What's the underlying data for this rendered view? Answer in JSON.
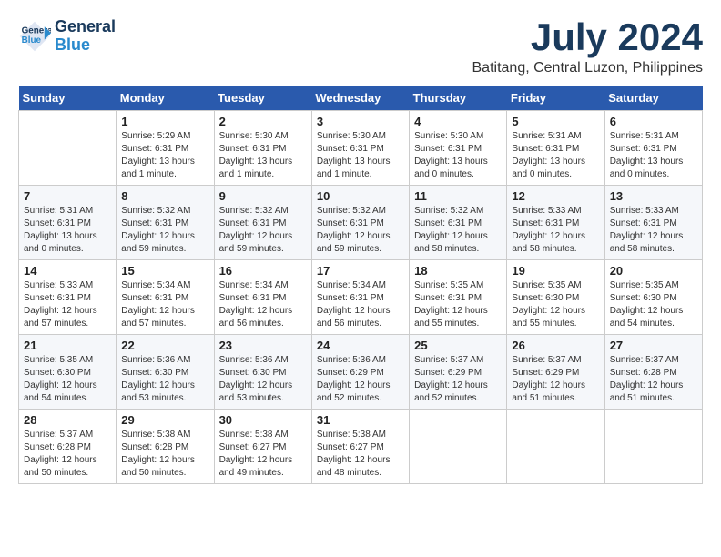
{
  "header": {
    "logo_line1": "General",
    "logo_line2": "Blue",
    "month": "July 2024",
    "location": "Batitang, Central Luzon, Philippines"
  },
  "days_of_week": [
    "Sunday",
    "Monday",
    "Tuesday",
    "Wednesday",
    "Thursday",
    "Friday",
    "Saturday"
  ],
  "weeks": [
    [
      {
        "day": "",
        "info": ""
      },
      {
        "day": "1",
        "info": "Sunrise: 5:29 AM\nSunset: 6:31 PM\nDaylight: 13 hours\nand 1 minute."
      },
      {
        "day": "2",
        "info": "Sunrise: 5:30 AM\nSunset: 6:31 PM\nDaylight: 13 hours\nand 1 minute."
      },
      {
        "day": "3",
        "info": "Sunrise: 5:30 AM\nSunset: 6:31 PM\nDaylight: 13 hours\nand 1 minute."
      },
      {
        "day": "4",
        "info": "Sunrise: 5:30 AM\nSunset: 6:31 PM\nDaylight: 13 hours\nand 0 minutes."
      },
      {
        "day": "5",
        "info": "Sunrise: 5:31 AM\nSunset: 6:31 PM\nDaylight: 13 hours\nand 0 minutes."
      },
      {
        "day": "6",
        "info": "Sunrise: 5:31 AM\nSunset: 6:31 PM\nDaylight: 13 hours\nand 0 minutes."
      }
    ],
    [
      {
        "day": "7",
        "info": "Sunrise: 5:31 AM\nSunset: 6:31 PM\nDaylight: 13 hours\nand 0 minutes."
      },
      {
        "day": "8",
        "info": "Sunrise: 5:32 AM\nSunset: 6:31 PM\nDaylight: 12 hours\nand 59 minutes."
      },
      {
        "day": "9",
        "info": "Sunrise: 5:32 AM\nSunset: 6:31 PM\nDaylight: 12 hours\nand 59 minutes."
      },
      {
        "day": "10",
        "info": "Sunrise: 5:32 AM\nSunset: 6:31 PM\nDaylight: 12 hours\nand 59 minutes."
      },
      {
        "day": "11",
        "info": "Sunrise: 5:32 AM\nSunset: 6:31 PM\nDaylight: 12 hours\nand 58 minutes."
      },
      {
        "day": "12",
        "info": "Sunrise: 5:33 AM\nSunset: 6:31 PM\nDaylight: 12 hours\nand 58 minutes."
      },
      {
        "day": "13",
        "info": "Sunrise: 5:33 AM\nSunset: 6:31 PM\nDaylight: 12 hours\nand 58 minutes."
      }
    ],
    [
      {
        "day": "14",
        "info": "Sunrise: 5:33 AM\nSunset: 6:31 PM\nDaylight: 12 hours\nand 57 minutes."
      },
      {
        "day": "15",
        "info": "Sunrise: 5:34 AM\nSunset: 6:31 PM\nDaylight: 12 hours\nand 57 minutes."
      },
      {
        "day": "16",
        "info": "Sunrise: 5:34 AM\nSunset: 6:31 PM\nDaylight: 12 hours\nand 56 minutes."
      },
      {
        "day": "17",
        "info": "Sunrise: 5:34 AM\nSunset: 6:31 PM\nDaylight: 12 hours\nand 56 minutes."
      },
      {
        "day": "18",
        "info": "Sunrise: 5:35 AM\nSunset: 6:31 PM\nDaylight: 12 hours\nand 55 minutes."
      },
      {
        "day": "19",
        "info": "Sunrise: 5:35 AM\nSunset: 6:30 PM\nDaylight: 12 hours\nand 55 minutes."
      },
      {
        "day": "20",
        "info": "Sunrise: 5:35 AM\nSunset: 6:30 PM\nDaylight: 12 hours\nand 54 minutes."
      }
    ],
    [
      {
        "day": "21",
        "info": "Sunrise: 5:35 AM\nSunset: 6:30 PM\nDaylight: 12 hours\nand 54 minutes."
      },
      {
        "day": "22",
        "info": "Sunrise: 5:36 AM\nSunset: 6:30 PM\nDaylight: 12 hours\nand 53 minutes."
      },
      {
        "day": "23",
        "info": "Sunrise: 5:36 AM\nSunset: 6:30 PM\nDaylight: 12 hours\nand 53 minutes."
      },
      {
        "day": "24",
        "info": "Sunrise: 5:36 AM\nSunset: 6:29 PM\nDaylight: 12 hours\nand 52 minutes."
      },
      {
        "day": "25",
        "info": "Sunrise: 5:37 AM\nSunset: 6:29 PM\nDaylight: 12 hours\nand 52 minutes."
      },
      {
        "day": "26",
        "info": "Sunrise: 5:37 AM\nSunset: 6:29 PM\nDaylight: 12 hours\nand 51 minutes."
      },
      {
        "day": "27",
        "info": "Sunrise: 5:37 AM\nSunset: 6:28 PM\nDaylight: 12 hours\nand 51 minutes."
      }
    ],
    [
      {
        "day": "28",
        "info": "Sunrise: 5:37 AM\nSunset: 6:28 PM\nDaylight: 12 hours\nand 50 minutes."
      },
      {
        "day": "29",
        "info": "Sunrise: 5:38 AM\nSunset: 6:28 PM\nDaylight: 12 hours\nand 50 minutes."
      },
      {
        "day": "30",
        "info": "Sunrise: 5:38 AM\nSunset: 6:27 PM\nDaylight: 12 hours\nand 49 minutes."
      },
      {
        "day": "31",
        "info": "Sunrise: 5:38 AM\nSunset: 6:27 PM\nDaylight: 12 hours\nand 48 minutes."
      },
      {
        "day": "",
        "info": ""
      },
      {
        "day": "",
        "info": ""
      },
      {
        "day": "",
        "info": ""
      }
    ]
  ]
}
